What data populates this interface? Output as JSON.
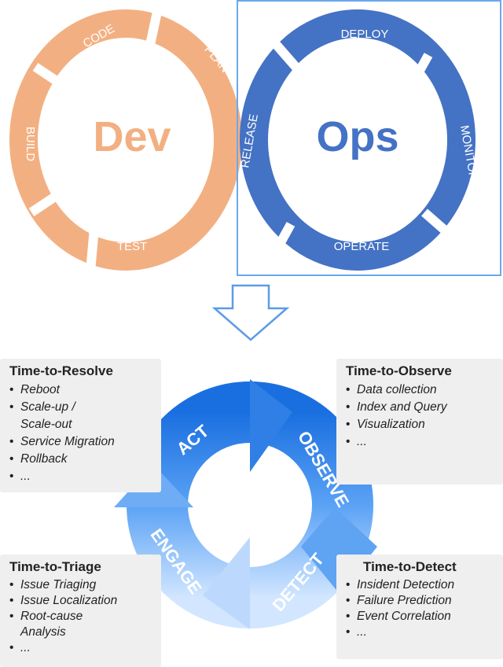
{
  "dev_cycle": {
    "center": "Dev",
    "stages": [
      "CODE",
      "PLAN",
      "BUILD",
      "TEST"
    ],
    "color": "#f2b082"
  },
  "ops_cycle": {
    "center": "Ops",
    "stages": [
      "DEPLOY",
      "RELEASE",
      "MONITOR",
      "OPERATE"
    ],
    "color": "#4472c4"
  },
  "loop": {
    "stages": [
      "ACT",
      "OBSERVE",
      "DETECT",
      "ENGAGE"
    ],
    "color_top": "#1a6fe0",
    "color_bottom": "#cfe4ff"
  },
  "boxes": {
    "resolve": {
      "title": "Time-to-Resolve",
      "items": [
        "Reboot",
        "Scale-up /\nScale-out",
        "Service Migration",
        "Rollback",
        "..."
      ]
    },
    "observe": {
      "title": "Time-to-Observe",
      "items": [
        "Data collection",
        "Index and Query",
        "Visualization",
        "..."
      ]
    },
    "triage": {
      "title": "Time-to-Triage",
      "items": [
        "Issue Triaging",
        "Issue Localization",
        "Root-cause\nAnalysis",
        "..."
      ]
    },
    "detect": {
      "title": "Time-to-Detect",
      "items": [
        "Insident Detection",
        "Failure Prediction",
        "Event Correlation",
        "..."
      ]
    }
  }
}
